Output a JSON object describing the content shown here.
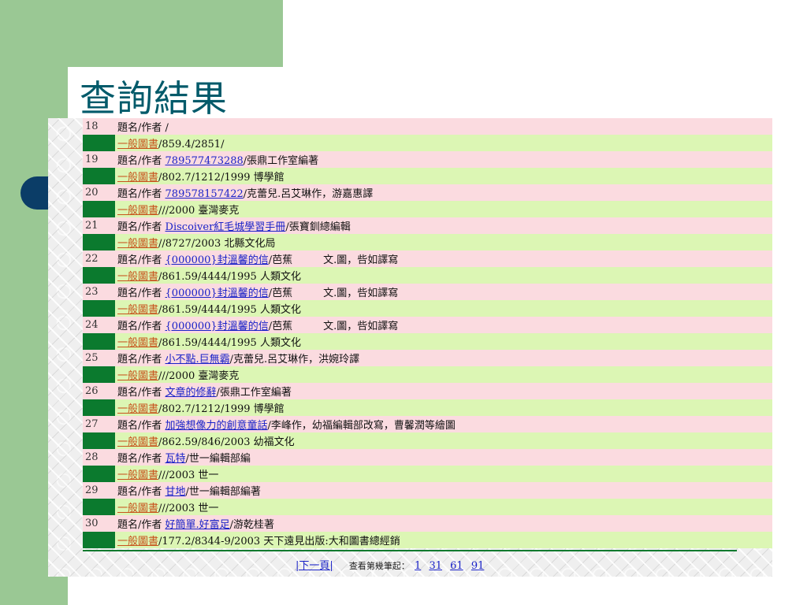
{
  "slide": {
    "title": "查詢結果"
  },
  "results": [
    {
      "num": "18",
      "label": "題名/作者",
      "title": "",
      "author": " /",
      "type": "一般圖書",
      "call": "/859.4/2851/"
    },
    {
      "num": "19",
      "label": "題名/作者",
      "title": "789577473288",
      "author": "/張鼎工作室編著",
      "type": "一般圖書",
      "call": "/802.7/1212/1999 博學館"
    },
    {
      "num": "20",
      "label": "題名/作者",
      "title": "789578157422",
      "author": "/克蕾兒.呂艾琳作，游嘉惠譯",
      "type": "一般圖書",
      "call": "///2000 臺灣麥克"
    },
    {
      "num": "21",
      "label": "題名/作者",
      "title": "Discoiver紅毛城學習手冊",
      "author": "/張寶釧總編輯",
      "type": "一般圖書",
      "call": "//8727/2003 北縣文化局"
    },
    {
      "num": "22",
      "label": "題名/作者",
      "title": "{000000}封溫馨的信",
      "author": "/芭蕉　　　文.圖，呰如譯寫",
      "type": "一般圖書",
      "call": "/861.59/4444/1995 人類文化"
    },
    {
      "num": "23",
      "label": "題名/作者",
      "title": "{000000}封溫馨的信",
      "author": "/芭蕉　　　文.圖，呰如譯寫",
      "type": "一般圖書",
      "call": "/861.59/4444/1995 人類文化"
    },
    {
      "num": "24",
      "label": "題名/作者",
      "title": "{000000}封溫馨的信",
      "author": "/芭蕉　　　文.圖，呰如譯寫",
      "type": "一般圖書",
      "call": "/861.59/4444/1995 人類文化"
    },
    {
      "num": "25",
      "label": "題名/作者",
      "title": "小不點.巨無霸",
      "author": "/克蕾兒.呂艾琳作，洪婉玲譯",
      "type": "一般圖書",
      "call": "///2000 臺灣麥克"
    },
    {
      "num": "26",
      "label": "題名/作者",
      "title": "文章的修辭",
      "author": "/張鼎工作室編著",
      "type": "一般圖書",
      "call": "/802.7/1212/1999 博學館"
    },
    {
      "num": "27",
      "label": "題名/作者",
      "title": "加強想像力的創意童話",
      "author": "/李峰作，幼福編輯部改寫，曹馨潤等繪圖",
      "type": "一般圖書",
      "call": "/862.59/846/2003 幼福文化"
    },
    {
      "num": "28",
      "label": "題名/作者",
      "title": "瓦特",
      "author": "/世一編輯部編",
      "type": "一般圖書",
      "call": "///2003 世一"
    },
    {
      "num": "29",
      "label": "題名/作者",
      "title": "甘地",
      "author": "/世一編輯部編著",
      "type": "一般圖書",
      "call": "///2003 世一"
    },
    {
      "num": "30",
      "label": "題名/作者",
      "title": "好簡單.好富足",
      "author": "/游乾桂著",
      "type": "一般圖書",
      "call": "/177.2/8344-9/2003 天下遠見出版:大和圖書總經銷"
    }
  ],
  "pager": {
    "next": "|下一頁|",
    "jump_label": "查看第幾筆起：",
    "pages": [
      "1",
      "31",
      "61",
      "91"
    ]
  },
  "colors": {
    "accent_green": "#9ac894",
    "row_pink": "#fbdbe0",
    "row_lime": "#dcf6b4",
    "dark_green": "#0b7a2e",
    "title_teal": "#005a6a",
    "bullet_navy": "#0b3d67"
  }
}
